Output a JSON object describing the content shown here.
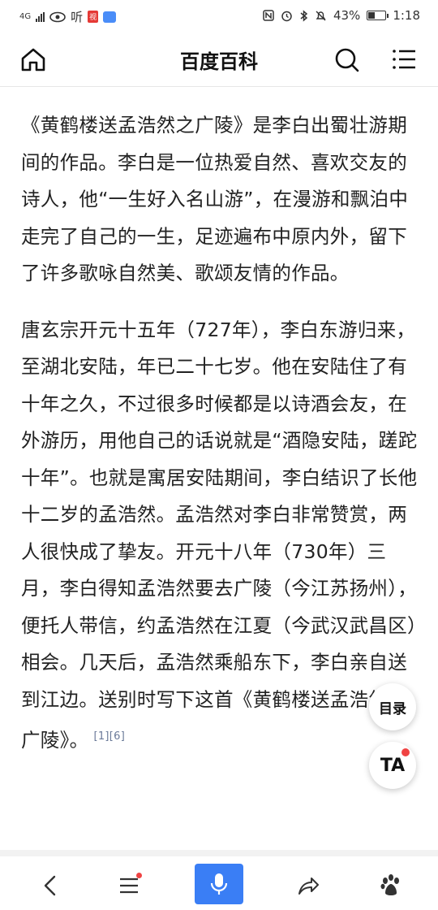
{
  "status_bar": {
    "network": "4G",
    "app_label": "听",
    "mini_badge": "视",
    "battery_percent": "43%",
    "battery_level": 0.43,
    "time": "1:18"
  },
  "header": {
    "title": "百度百科"
  },
  "article": {
    "paragraph1": "《黄鹤楼送孟浩然之广陵》是李白出蜀壮游期间的作品。李白是一位热爱自然、喜欢交友的诗人，他“一生好入名山游”，在漫游和飘泊中走完了自己的一生，足迹遍布中原内外，留下了许多歌咏自然美、歌颂友情的作品。",
    "paragraph2": "唐玄宗开元十五年（727年），李白东游归来，至湖北安陆，年已二十七岁。他在安陆住了有十年之久，不过很多时候都是以诗酒会友，在外游历，用他自己的话说就是“酒隐安陆，蹉跎十年”。也就是寓居安陆期间，李白结识了长他十二岁的孟浩然。孟浩然对李白非常赞赏，两人很快成了挚友。开元十八年（730年）三月，李白得知孟浩然要去广陵（今江苏扬州），便托人带信，约孟浩然在江夏（今武汉武昌区）相会。几天后，孟浩然乘船东下，李白亲自送到江边。送别时写下这首《黄鹤楼送孟浩然之广陵》。",
    "references": "[1][6]"
  },
  "floating": {
    "toc_label": "目录",
    "ta_label": "TA"
  },
  "colors": {
    "accent": "#3a7ef5",
    "notify_dot": "#f04343"
  },
  "icons": [
    "home-icon",
    "search-icon",
    "menu-icon",
    "back-icon",
    "list-icon",
    "mic-icon",
    "share-icon",
    "baidu-paw-icon"
  ]
}
